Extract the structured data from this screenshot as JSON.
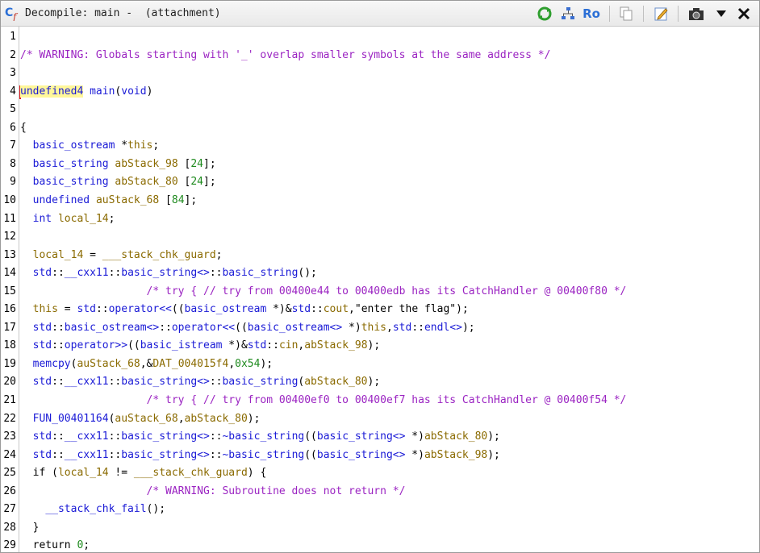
{
  "window": {
    "title": "Decompile: main -  (attachment)",
    "icon_label": "C"
  },
  "toolbar": {
    "buttons": [
      {
        "name": "refresh",
        "icon": "refresh-icon"
      },
      {
        "name": "graph",
        "icon": "graph-icon"
      },
      {
        "name": "readonly",
        "icon": "ro-icon",
        "label": "Ro"
      },
      {
        "name": "copy",
        "icon": "copy-icon"
      },
      {
        "name": "edit",
        "icon": "edit-icon"
      },
      {
        "name": "snapshot",
        "icon": "camera-icon"
      },
      {
        "name": "menu",
        "icon": "chevron-down-icon"
      },
      {
        "name": "close",
        "icon": "close-icon"
      }
    ]
  },
  "colors": {
    "comment": "#9b24c2",
    "type": "#1a1ad6",
    "variable": "#8a6a00",
    "number": "#1e8a1e",
    "highlight": "#fff79a"
  },
  "code_lines": [
    {
      "n": "1",
      "tokens": []
    },
    {
      "n": "2",
      "tokens": [
        [
          "comment",
          "/* WARNING: Globals starting with '_' overlap smaller symbols at the same address */"
        ]
      ]
    },
    {
      "n": "3",
      "tokens": []
    },
    {
      "n": "4",
      "tokens": [
        [
          "type hl",
          "undefined4"
        ],
        [
          "plain",
          " "
        ],
        [
          "fn",
          "main"
        ],
        [
          "plain",
          "("
        ],
        [
          "type",
          "void"
        ],
        [
          "plain",
          ")"
        ]
      ]
    },
    {
      "n": "5",
      "tokens": []
    },
    {
      "n": "6",
      "tokens": [
        [
          "plain",
          "{"
        ]
      ]
    },
    {
      "n": "7",
      "tokens": [
        [
          "plain",
          "  "
        ],
        [
          "type",
          "basic_ostream"
        ],
        [
          "plain",
          " *"
        ],
        [
          "var",
          "this"
        ],
        [
          "plain",
          ";"
        ]
      ]
    },
    {
      "n": "8",
      "tokens": [
        [
          "plain",
          "  "
        ],
        [
          "type",
          "basic_string"
        ],
        [
          "plain",
          " "
        ],
        [
          "var",
          "abStack_98"
        ],
        [
          "plain",
          " ["
        ],
        [
          "num",
          "24"
        ],
        [
          "plain",
          "];"
        ]
      ]
    },
    {
      "n": "9",
      "tokens": [
        [
          "plain",
          "  "
        ],
        [
          "type",
          "basic_string"
        ],
        [
          "plain",
          " "
        ],
        [
          "var",
          "abStack_80"
        ],
        [
          "plain",
          " ["
        ],
        [
          "num",
          "24"
        ],
        [
          "plain",
          "];"
        ]
      ]
    },
    {
      "n": "10",
      "tokens": [
        [
          "plain",
          "  "
        ],
        [
          "type",
          "undefined"
        ],
        [
          "plain",
          " "
        ],
        [
          "var",
          "auStack_68"
        ],
        [
          "plain",
          " ["
        ],
        [
          "num",
          "84"
        ],
        [
          "plain",
          "];"
        ]
      ]
    },
    {
      "n": "11",
      "tokens": [
        [
          "plain",
          "  "
        ],
        [
          "type",
          "int"
        ],
        [
          "plain",
          " "
        ],
        [
          "var",
          "local_14"
        ],
        [
          "plain",
          ";"
        ]
      ]
    },
    {
      "n": "12",
      "tokens": []
    },
    {
      "n": "13",
      "tokens": [
        [
          "plain",
          "  "
        ],
        [
          "var",
          "local_14"
        ],
        [
          "plain",
          " = "
        ],
        [
          "global",
          "___stack_chk_guard"
        ],
        [
          "plain",
          ";"
        ]
      ]
    },
    {
      "n": "14",
      "tokens": [
        [
          "plain",
          "  "
        ],
        [
          "ns",
          "std"
        ],
        [
          "plain",
          "::"
        ],
        [
          "ns",
          "__cxx11"
        ],
        [
          "plain",
          "::"
        ],
        [
          "ns",
          "basic_string<>"
        ],
        [
          "plain",
          "::"
        ],
        [
          "fn",
          "basic_string"
        ],
        [
          "plain",
          "();"
        ]
      ]
    },
    {
      "n": "15",
      "tokens": [
        [
          "plain",
          "                    "
        ],
        [
          "comment",
          "/* try { // try from 00400e44 to 00400edb has its CatchHandler @ 00400f80 */"
        ]
      ]
    },
    {
      "n": "16",
      "tokens": [
        [
          "plain",
          "  "
        ],
        [
          "var",
          "this"
        ],
        [
          "plain",
          " = "
        ],
        [
          "ns",
          "std"
        ],
        [
          "plain",
          "::"
        ],
        [
          "fn",
          "operator<<"
        ],
        [
          "plain",
          "(("
        ],
        [
          "type",
          "basic_ostream"
        ],
        [
          "plain",
          " *)&"
        ],
        [
          "ns",
          "std"
        ],
        [
          "plain",
          "::"
        ],
        [
          "global",
          "cout"
        ],
        [
          "plain",
          ","
        ],
        [
          "str",
          "\"enter the flag\""
        ],
        [
          "plain",
          ");"
        ]
      ]
    },
    {
      "n": "17",
      "tokens": [
        [
          "plain",
          "  "
        ],
        [
          "ns",
          "std"
        ],
        [
          "plain",
          "::"
        ],
        [
          "ns",
          "basic_ostream<>"
        ],
        [
          "plain",
          "::"
        ],
        [
          "fn",
          "operator<<"
        ],
        [
          "plain",
          "(("
        ],
        [
          "type",
          "basic_ostream<>"
        ],
        [
          "plain",
          " *)"
        ],
        [
          "var",
          "this"
        ],
        [
          "plain",
          ","
        ],
        [
          "ns",
          "std"
        ],
        [
          "plain",
          "::"
        ],
        [
          "fn",
          "endl<>"
        ],
        [
          "plain",
          ");"
        ]
      ]
    },
    {
      "n": "18",
      "tokens": [
        [
          "plain",
          "  "
        ],
        [
          "ns",
          "std"
        ],
        [
          "plain",
          "::"
        ],
        [
          "fn",
          "operator>>"
        ],
        [
          "plain",
          "(("
        ],
        [
          "type",
          "basic_istream"
        ],
        [
          "plain",
          " *)&"
        ],
        [
          "ns",
          "std"
        ],
        [
          "plain",
          "::"
        ],
        [
          "global",
          "cin"
        ],
        [
          "plain",
          ","
        ],
        [
          "var",
          "abStack_98"
        ],
        [
          "plain",
          ");"
        ]
      ]
    },
    {
      "n": "19",
      "tokens": [
        [
          "plain",
          "  "
        ],
        [
          "fn",
          "memcpy"
        ],
        [
          "plain",
          "("
        ],
        [
          "var",
          "auStack_68"
        ],
        [
          "plain",
          ",&"
        ],
        [
          "global",
          "DAT_004015f4"
        ],
        [
          "plain",
          ","
        ],
        [
          "num",
          "0x54"
        ],
        [
          "plain",
          ");"
        ]
      ]
    },
    {
      "n": "20",
      "tokens": [
        [
          "plain",
          "  "
        ],
        [
          "ns",
          "std"
        ],
        [
          "plain",
          "::"
        ],
        [
          "ns",
          "__cxx11"
        ],
        [
          "plain",
          "::"
        ],
        [
          "ns",
          "basic_string<>"
        ],
        [
          "plain",
          "::"
        ],
        [
          "fn",
          "basic_string"
        ],
        [
          "plain",
          "("
        ],
        [
          "var",
          "abStack_80"
        ],
        [
          "plain",
          ");"
        ]
      ]
    },
    {
      "n": "21",
      "tokens": [
        [
          "plain",
          "                    "
        ],
        [
          "comment",
          "/* try { // try from 00400ef0 to 00400ef7 has its CatchHandler @ 00400f54 */"
        ]
      ]
    },
    {
      "n": "22",
      "tokens": [
        [
          "plain",
          "  "
        ],
        [
          "fn",
          "FUN_00401164"
        ],
        [
          "plain",
          "("
        ],
        [
          "var",
          "auStack_68"
        ],
        [
          "plain",
          ","
        ],
        [
          "var",
          "abStack_80"
        ],
        [
          "plain",
          ");"
        ]
      ]
    },
    {
      "n": "23",
      "tokens": [
        [
          "plain",
          "  "
        ],
        [
          "ns",
          "std"
        ],
        [
          "plain",
          "::"
        ],
        [
          "ns",
          "__cxx11"
        ],
        [
          "plain",
          "::"
        ],
        [
          "ns",
          "basic_string<>"
        ],
        [
          "plain",
          "::"
        ],
        [
          "fn",
          "~basic_string"
        ],
        [
          "plain",
          "(("
        ],
        [
          "type",
          "basic_string<>"
        ],
        [
          "plain",
          " *)"
        ],
        [
          "var",
          "abStack_80"
        ],
        [
          "plain",
          ");"
        ]
      ]
    },
    {
      "n": "24",
      "tokens": [
        [
          "plain",
          "  "
        ],
        [
          "ns",
          "std"
        ],
        [
          "plain",
          "::"
        ],
        [
          "ns",
          "__cxx11"
        ],
        [
          "plain",
          "::"
        ],
        [
          "ns",
          "basic_string<>"
        ],
        [
          "plain",
          "::"
        ],
        [
          "fn",
          "~basic_string"
        ],
        [
          "plain",
          "(("
        ],
        [
          "type",
          "basic_string<>"
        ],
        [
          "plain",
          " *)"
        ],
        [
          "var",
          "abStack_98"
        ],
        [
          "plain",
          ");"
        ]
      ]
    },
    {
      "n": "25",
      "tokens": [
        [
          "plain",
          "  "
        ],
        [
          "kw",
          "if"
        ],
        [
          "plain",
          " ("
        ],
        [
          "var",
          "local_14"
        ],
        [
          "plain",
          " != "
        ],
        [
          "global",
          "___stack_chk_guard"
        ],
        [
          "plain",
          ") {"
        ]
      ]
    },
    {
      "n": "26",
      "tokens": [
        [
          "plain",
          "                    "
        ],
        [
          "comment",
          "/* WARNING: Subroutine does not return */"
        ]
      ]
    },
    {
      "n": "27",
      "tokens": [
        [
          "plain",
          "    "
        ],
        [
          "fn",
          "__stack_chk_fail"
        ],
        [
          "plain",
          "();"
        ]
      ]
    },
    {
      "n": "28",
      "tokens": [
        [
          "plain",
          "  }"
        ]
      ]
    },
    {
      "n": "29",
      "tokens": [
        [
          "plain",
          "  "
        ],
        [
          "kw",
          "return"
        ],
        [
          "plain",
          " "
        ],
        [
          "num",
          "0"
        ],
        [
          "plain",
          ";"
        ]
      ]
    }
  ]
}
